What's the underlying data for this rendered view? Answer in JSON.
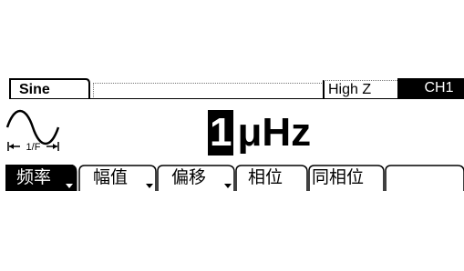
{
  "status_bar": {
    "waveform": "Sine",
    "load": "High Z",
    "channel": "CH1"
  },
  "icon": {
    "name": "sine-wave-icon",
    "period_label": "1/F"
  },
  "readout": {
    "cursor_digit": "1",
    "unit": "μHz"
  },
  "softkeys": [
    {
      "label": "频率",
      "active": true,
      "submenu": true
    },
    {
      "label": "幅值",
      "active": false,
      "submenu": true
    },
    {
      "label": "偏移",
      "active": false,
      "submenu": true
    },
    {
      "label": "相位",
      "active": false,
      "submenu": false
    },
    {
      "label": "同相位",
      "active": false,
      "submenu": false
    }
  ],
  "colors": {
    "foreground": "#000000",
    "background": "#ffffff"
  }
}
